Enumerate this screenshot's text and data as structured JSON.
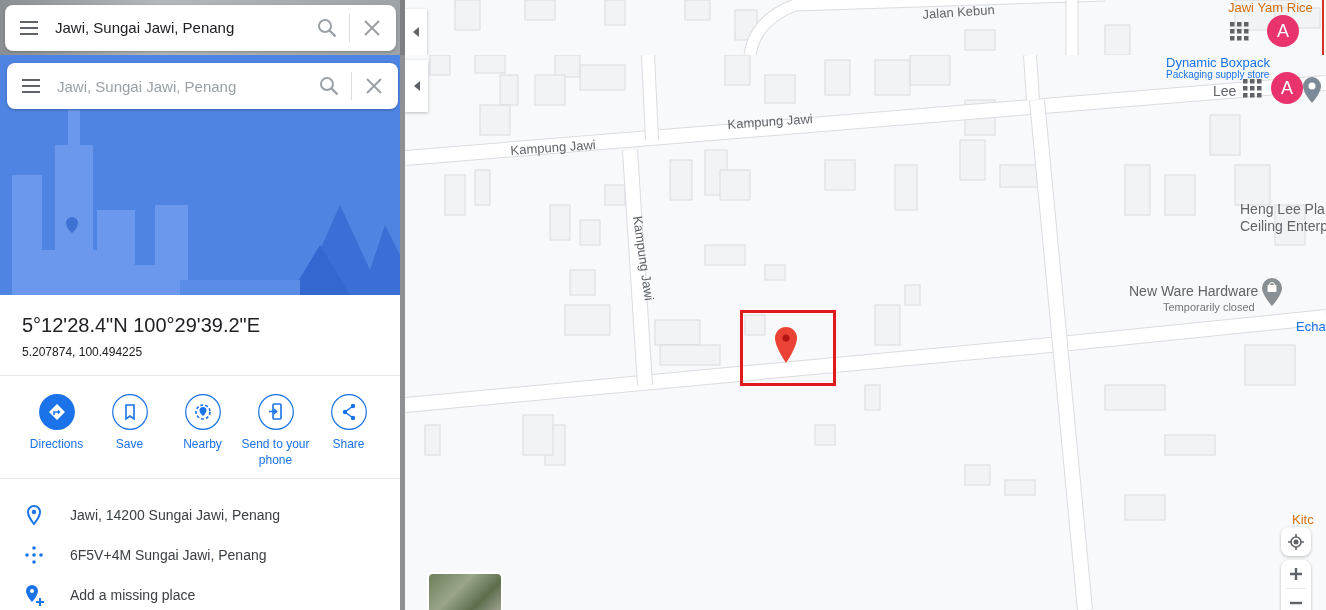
{
  "top_strip": {
    "search": {
      "value": "Jawi, Sungai Jawi, Penang"
    },
    "map_labels": [
      {
        "text": "Jalan Kebun",
        "kind": "road"
      },
      {
        "text": "Jawi Yam Rice",
        "kind": "restaurant"
      }
    ],
    "account": {
      "letter": "A"
    }
  },
  "search": {
    "placeholder": "Jawi, Sungai Jawi, Penang"
  },
  "place": {
    "title": "5°12'28.4\"N 100°29'39.2\"E",
    "coords": "5.207874, 100.494225"
  },
  "actions": [
    {
      "label": "Directions",
      "kind": "directions",
      "primary": true
    },
    {
      "label": "Save",
      "kind": "save",
      "primary": false
    },
    {
      "label": "Nearby",
      "kind": "nearby",
      "primary": false
    },
    {
      "label": "Send to your phone",
      "kind": "send",
      "primary": false
    },
    {
      "label": "Share",
      "kind": "share",
      "primary": false
    }
  ],
  "details": [
    {
      "kind": "address",
      "text": "Jawi, 14200 Sungai Jawi, Penang"
    },
    {
      "kind": "pluscode",
      "text": "6F5V+4M Sungai Jawi, Penang"
    },
    {
      "kind": "add_place",
      "text": "Add a missing place"
    }
  ],
  "map": {
    "account": {
      "letter": "A"
    },
    "labels": [
      {
        "text": "Dynamic Boxpack",
        "kind": "business"
      },
      {
        "text": "Packaging supply store",
        "kind": "business_sub"
      },
      {
        "text": "Lee",
        "kind": "place"
      },
      {
        "text": "Kampung Jawi",
        "kind": "road"
      },
      {
        "text": "Kampung Jawi",
        "kind": "road"
      },
      {
        "text": "Kampung Jawi",
        "kind": "road"
      },
      {
        "text": "Heng Lee Pla",
        "kind": "place"
      },
      {
        "text": "Ceiling Enterp",
        "kind": "place"
      },
      {
        "text": "New Ware Hardware",
        "kind": "place"
      },
      {
        "text": "Temporarily closed",
        "kind": "status"
      },
      {
        "text": "Echa",
        "kind": "business"
      },
      {
        "text": "Kitc",
        "kind": "restaurant"
      }
    ]
  }
}
